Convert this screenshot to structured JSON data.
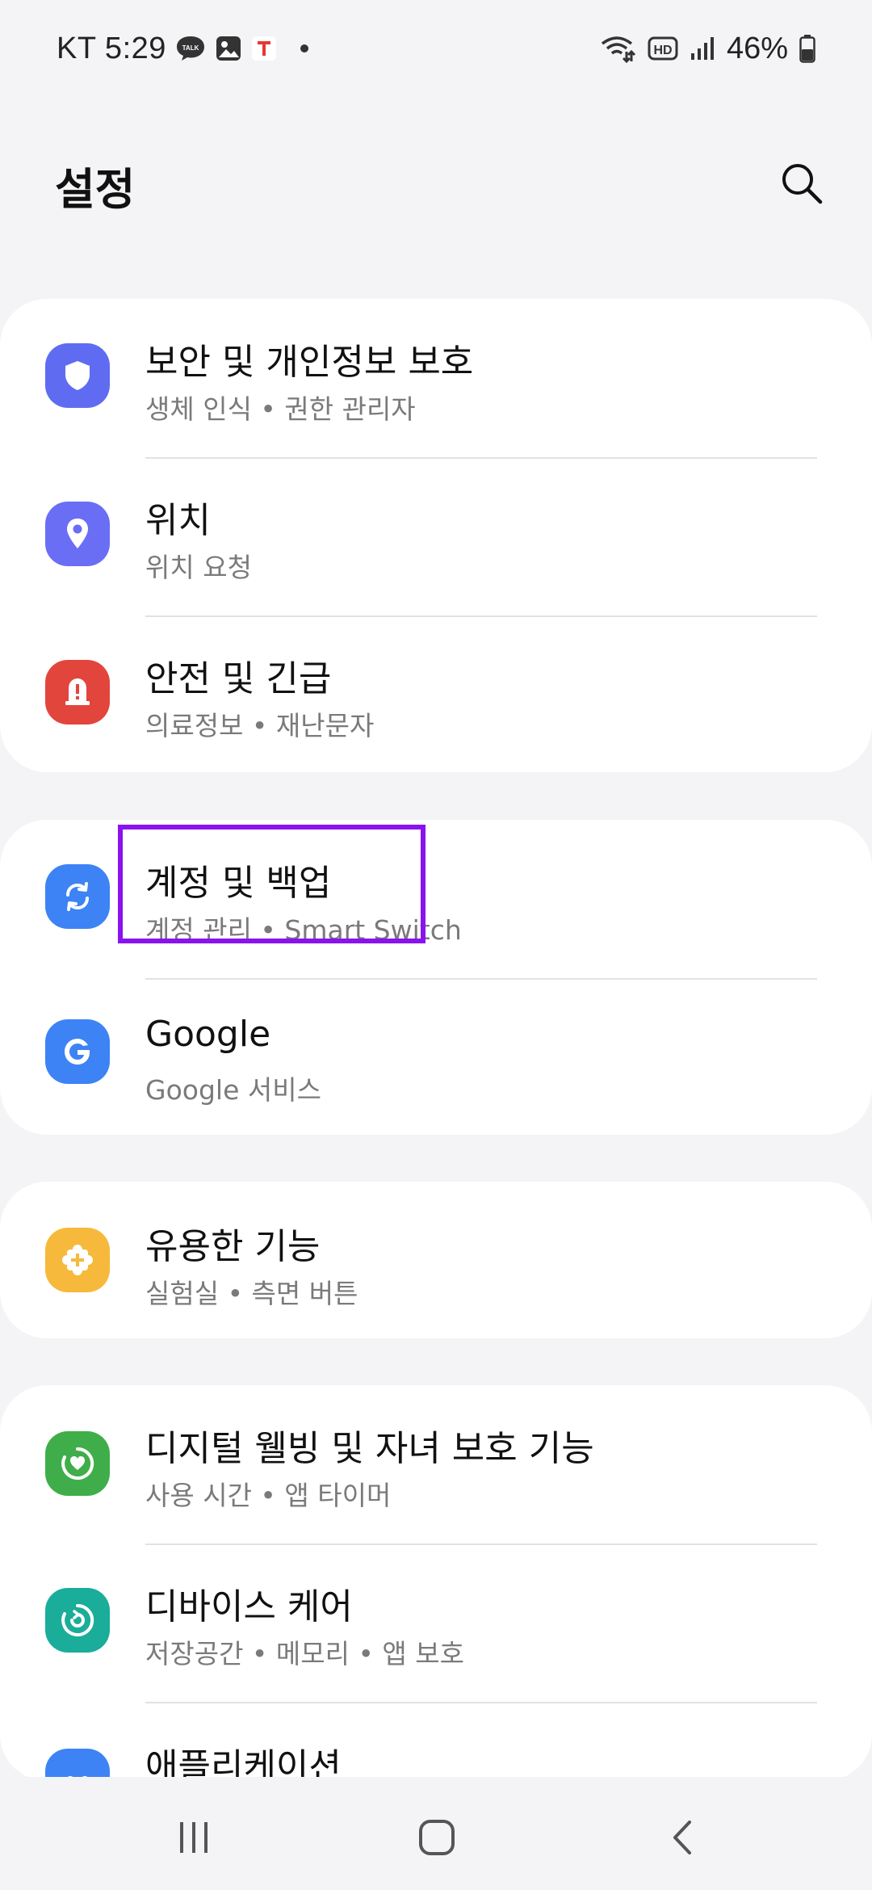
{
  "status_bar": {
    "time": "KT 5:29",
    "battery": "46%",
    "icons_left": [
      "talk-icon",
      "gallery-icon",
      "tmap-icon"
    ],
    "icons_right": [
      "wifi-call-icon",
      "hd-icon",
      "signal-icon",
      "battery-icon"
    ]
  },
  "header": {
    "title": "설정",
    "search_icon": "search-icon"
  },
  "groups": [
    {
      "items": [
        {
          "title": "보안 및 개인정보 보호",
          "subtitle": "생체 인식  •  권한 관리자",
          "icon": "shield-icon",
          "color": "#5f6cf2"
        },
        {
          "title": "위치",
          "subtitle": "위치 요청",
          "icon": "location-pin-icon",
          "color": "#6a6ef5"
        },
        {
          "title": "안전 및 긴급",
          "subtitle": "의료정보  •  재난문자",
          "icon": "emergency-siren-icon",
          "color": "#e2453c"
        }
      ]
    },
    {
      "items": [
        {
          "title": "계정 및 백업",
          "subtitle": "계정 관리  •  Smart Switch",
          "icon": "sync-icon",
          "color": "#3d83f5"
        },
        {
          "title": "Google",
          "subtitle": "Google 서비스",
          "icon": "google-g-icon",
          "color": "#3d83f5"
        }
      ]
    },
    {
      "items": [
        {
          "title": "유용한 기능",
          "subtitle": "실험실  •  측면 버튼",
          "icon": "puzzle-plus-icon",
          "color": "#f6b93b"
        }
      ]
    },
    {
      "items": [
        {
          "title": "디지털 웰빙 및 자녀 보호 기능",
          "subtitle": "사용 시간  •  앱 타이머",
          "icon": "wellbeing-heart-icon",
          "color": "#3fae4a"
        },
        {
          "title": "디바이스 케어",
          "subtitle": "저장공간  •  메모리  •  앱 보호",
          "icon": "device-care-icon",
          "color": "#19ad9a"
        },
        {
          "title": "애플리케이션",
          "subtitle": "",
          "icon": "apps-icon",
          "color": "#3d83f5"
        }
      ]
    }
  ],
  "nav_bar": {
    "recents": "recents-icon",
    "home": "home-icon",
    "back": "back-icon"
  }
}
